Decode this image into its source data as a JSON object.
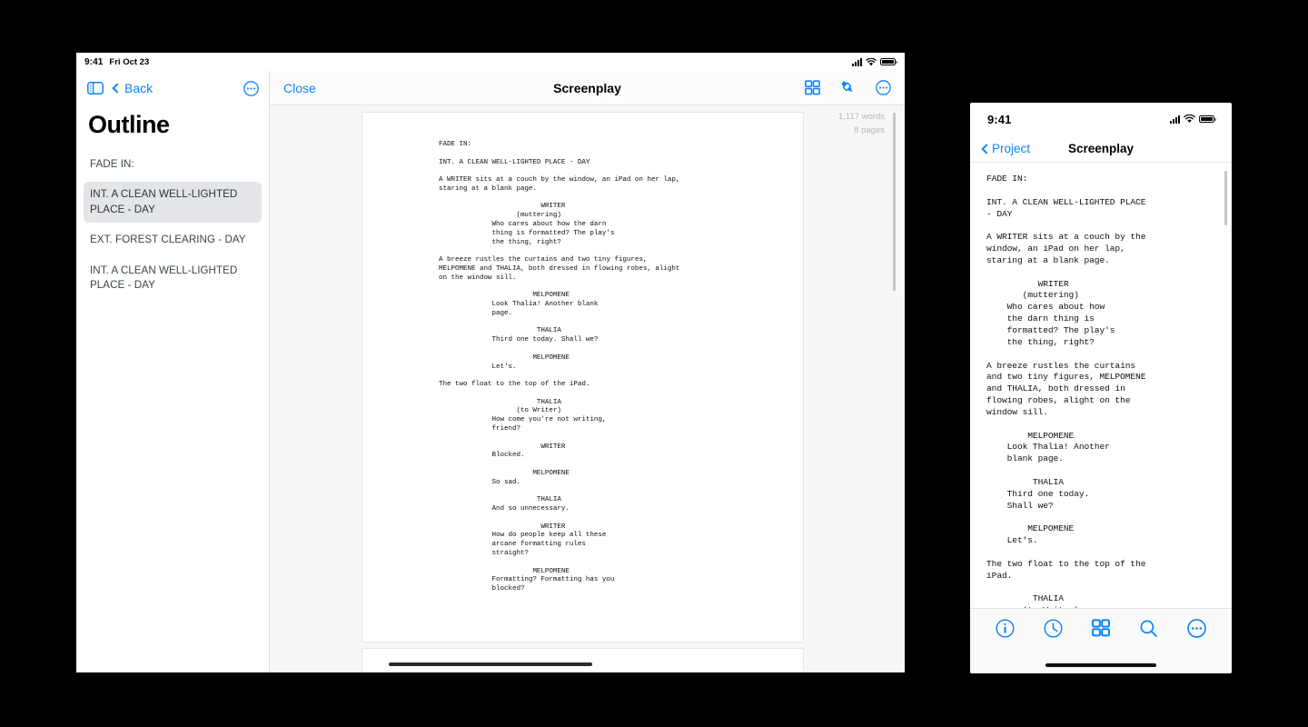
{
  "ipad": {
    "status_bar": {
      "time": "9:41",
      "date": "Fri Oct 23",
      "cellular_icon": "signal-bars-icon",
      "wifi_icon": "wifi-icon",
      "battery_icon": "battery-icon"
    },
    "sidebar": {
      "toggle_icon": "sidebar-toggle-icon",
      "back_label": "Back",
      "more_icon": "more-circle-icon",
      "title": "Outline",
      "items": [
        {
          "label": "FADE IN:",
          "selected": false
        },
        {
          "label": "INT. A CLEAN WELL-LIGHTED PLACE - DAY",
          "selected": true
        },
        {
          "label": "EXT. FOREST CLEARING - DAY",
          "selected": false
        },
        {
          "label": "INT. A CLEAN WELL-LIGHTED PLACE - DAY",
          "selected": false
        }
      ]
    },
    "detail": {
      "close_label": "Close",
      "title": "Screenplay",
      "tools": [
        {
          "name": "grid-view-icon"
        },
        {
          "name": "highlighter-icon"
        },
        {
          "name": "more-circle-icon"
        }
      ],
      "word_count": "1,117 words",
      "page_count": "8 pages",
      "script": "FADE IN:\n\nINT. A CLEAN WELL-LIGHTED PLACE - DAY\n\nA WRITER sits at a couch by the window, an iPad on her lap,\nstaring at a blank page.\n\n                         WRITER\n                   (muttering)\n             Who cares about how the darn\n             thing is formatted? The play's\n             the thing, right?\n\nA breeze rustles the curtains and two tiny figures,\nMELPOMENE and THALIA, both dressed in flowing robes, alight\non the window sill.\n\n                       MELPOMENE\n             Look Thalia! Another blank\n             page.\n\n                        THALIA\n             Third one today. Shall we?\n\n                       MELPOMENE\n             Let's.\n\nThe two float to the top of the iPad.\n\n                        THALIA\n                   (to Writer)\n             How come you're not writing,\n             friend?\n\n                         WRITER\n             Blocked.\n\n                       MELPOMENE\n             So sad.\n\n                        THALIA\n             And so unnecessary.\n\n                         WRITER\n             How do people keep all these\n             arcane formatting rules\n             straight?\n\n                       MELPOMENE\n             Formatting? Formatting has you\n             blocked?"
    },
    "home_indicator": "home-indicator"
  },
  "iphone": {
    "status_bar": {
      "time": "9:41",
      "cellular_icon": "signal-bars-icon",
      "wifi_icon": "wifi-icon",
      "battery_icon": "battery-icon"
    },
    "nav": {
      "back_label": "Project",
      "title": "Screenplay"
    },
    "script": "FADE IN:\n\nINT. A CLEAN WELL-LIGHTED PLACE\n- DAY\n\nA WRITER sits at a couch by the\nwindow, an iPad on her lap,\nstaring at a blank page.\n\n          WRITER\n       (muttering)\n    Who cares about how\n    the darn thing is\n    formatted? The play's\n    the thing, right?\n\nA breeze rustles the curtains\nand two tiny figures, MELPOMENE\nand THALIA, both dressed in\nflowing robes, alight on the\nwindow sill.\n\n        MELPOMENE\n    Look Thalia! Another\n    blank page.\n\n         THALIA\n    Third one today.\n    Shall we?\n\n        MELPOMENE\n    Let's.\n\nThe two float to the top of the\niPad.\n\n         THALIA\n       (to Writer)",
    "tabs": [
      {
        "name": "info-icon"
      },
      {
        "name": "history-clock-icon"
      },
      {
        "name": "grid-view-icon"
      },
      {
        "name": "search-icon"
      },
      {
        "name": "more-circle-icon"
      }
    ],
    "home_indicator": "home-indicator"
  },
  "theme": {
    "accent": "#0a84ff",
    "selected_row_bg": "#e3e5e8",
    "page_bg": "#f7f7f7"
  }
}
